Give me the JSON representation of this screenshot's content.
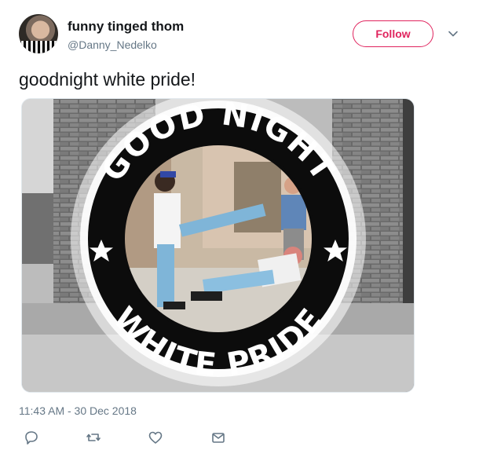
{
  "user": {
    "display_name": "funny tinged thom",
    "handle": "@Danny_Nedelko"
  },
  "header": {
    "follow_label": "Follow"
  },
  "tweet": {
    "text": "goodnight white pride!",
    "timestamp": "11:43 AM - 30 Dec 2018"
  },
  "media": {
    "ring_top_text": "GOOD NIGHT",
    "ring_bottom_text": "WHITE PRIDE"
  },
  "actions": {
    "icons": [
      "reply-icon",
      "retweet-icon",
      "like-icon",
      "direct-message-icon"
    ]
  },
  "colors": {
    "follow_accent": "#e0245e",
    "secondary_text": "#657786",
    "primary_text": "#14171a"
  }
}
